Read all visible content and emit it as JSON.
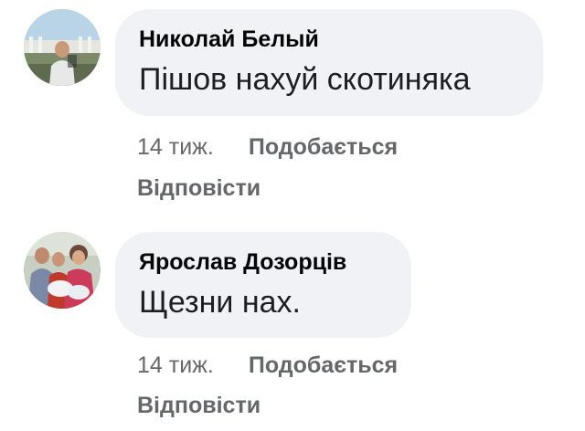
{
  "comments": [
    {
      "author": "Николай Белый",
      "text": "Пішов нахуй скотиняка",
      "time": "14 тиж.",
      "like_label": "Подобається",
      "reply_label": "Відповісти",
      "avatar_icon": "user-avatar-photo"
    },
    {
      "author": "Ярослав Дозорців",
      "text": "Щезни нах.",
      "time": "14 тиж.",
      "like_label": "Подобається",
      "reply_label": "Відповісти",
      "avatar_icon": "user-avatar-photo"
    }
  ],
  "colors": {
    "bubble_bg": "#f0f2f5",
    "author_text": "#050505",
    "secondary_text": "#65676b"
  }
}
